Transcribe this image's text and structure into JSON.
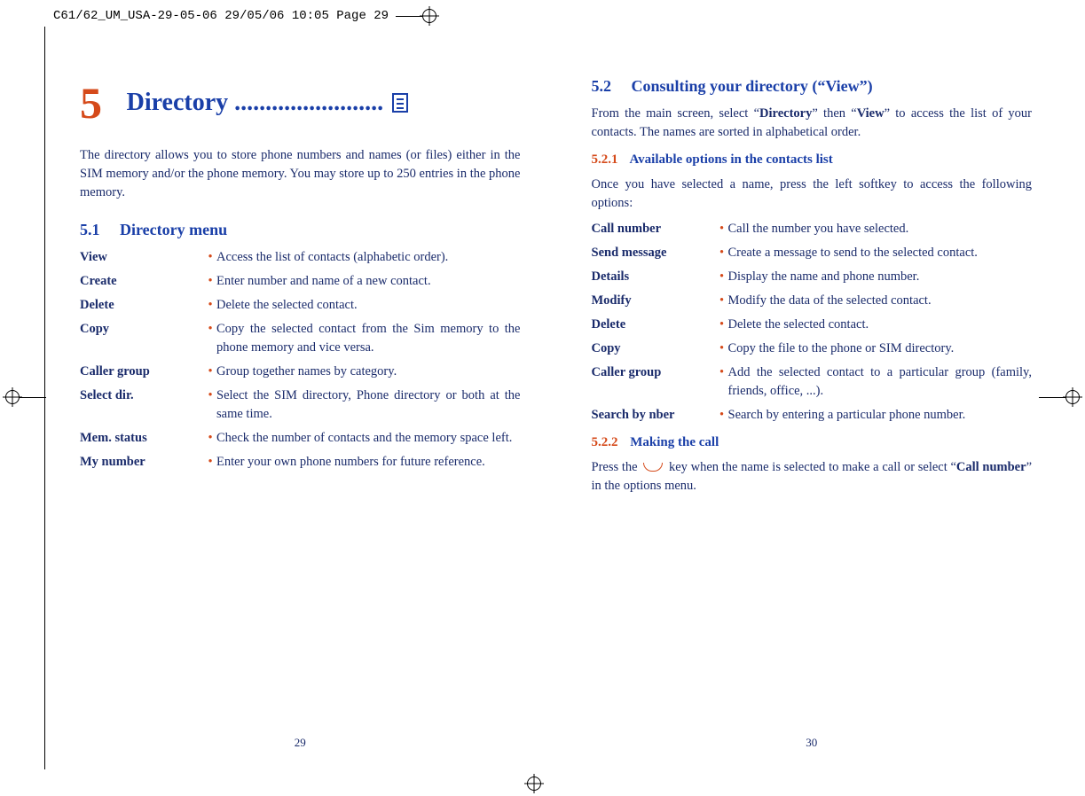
{
  "slug": "C61/62_UM_USA-29-05-06  29/05/06  10:05  Page 29",
  "left": {
    "chapter_number": "5",
    "chapter_title": "Directory ",
    "chapter_dots": "........................",
    "intro": "The directory allows you to store phone numbers and names (or files) either in the SIM memory and/or the phone memory. You may store up to 250 entries in the phone memory.",
    "sec_num": "5.1",
    "sec_title": "Directory menu",
    "items": [
      {
        "term": "View",
        "def": "Access the list of contacts (alphabetic order)."
      },
      {
        "term": "Create",
        "def": "Enter number and name of a new contact."
      },
      {
        "term": "Delete",
        "def": "Delete the selected contact."
      },
      {
        "term": "Copy",
        "def": "Copy the selected contact from the Sim memory to the phone memory and vice versa."
      },
      {
        "term": "Caller group",
        "def": "Group together names by category."
      },
      {
        "term": "Select dir.",
        "def": "Select the SIM directory, Phone directory or both at the same time."
      },
      {
        "term": "Mem. status",
        "def": "Check the number of contacts and the memory space left."
      },
      {
        "term": "My number",
        "def": "Enter your own phone numbers for future reference."
      }
    ],
    "page_number": "29"
  },
  "right": {
    "sec_num": "5.2",
    "sec_title": "Consulting your directory (“View”)",
    "intro_pre": "From the main screen, select “",
    "intro_b1": "Directory",
    "intro_mid": "” then “",
    "intro_b2": "View",
    "intro_post": "” to access the list of your contacts. The names are sorted in alphabetical order.",
    "sub1_num": "5.2.1",
    "sub1_title": "Available options in the contacts list",
    "sub1_intro": "Once you have selected a name, press the left softkey to access the following options:",
    "items": [
      {
        "term": "Call number",
        "def": "Call the number you have selected."
      },
      {
        "term": "Send message",
        "def": "Create a message to send to the selected contact."
      },
      {
        "term": "Details",
        "def": "Display the name and phone number."
      },
      {
        "term": "Modify",
        "def": "Modify the data of the selected contact."
      },
      {
        "term": "Delete",
        "def": "Delete the selected contact."
      },
      {
        "term": "Copy",
        "def": "Copy the file to the phone or SIM directory."
      },
      {
        "term": "Caller group",
        "def": "Add the selected contact to a particular group (family, friends, office, ...)."
      },
      {
        "term": "Search by nber",
        "def": "Search by entering a particular phone number."
      }
    ],
    "sub2_num": "5.2.2",
    "sub2_title": "Making the call",
    "call_pre": "Press the ",
    "call_mid": " key when the name is selected to make a call or select “",
    "call_b": "Call number",
    "call_post": "” in the options menu.",
    "page_number": "30"
  }
}
